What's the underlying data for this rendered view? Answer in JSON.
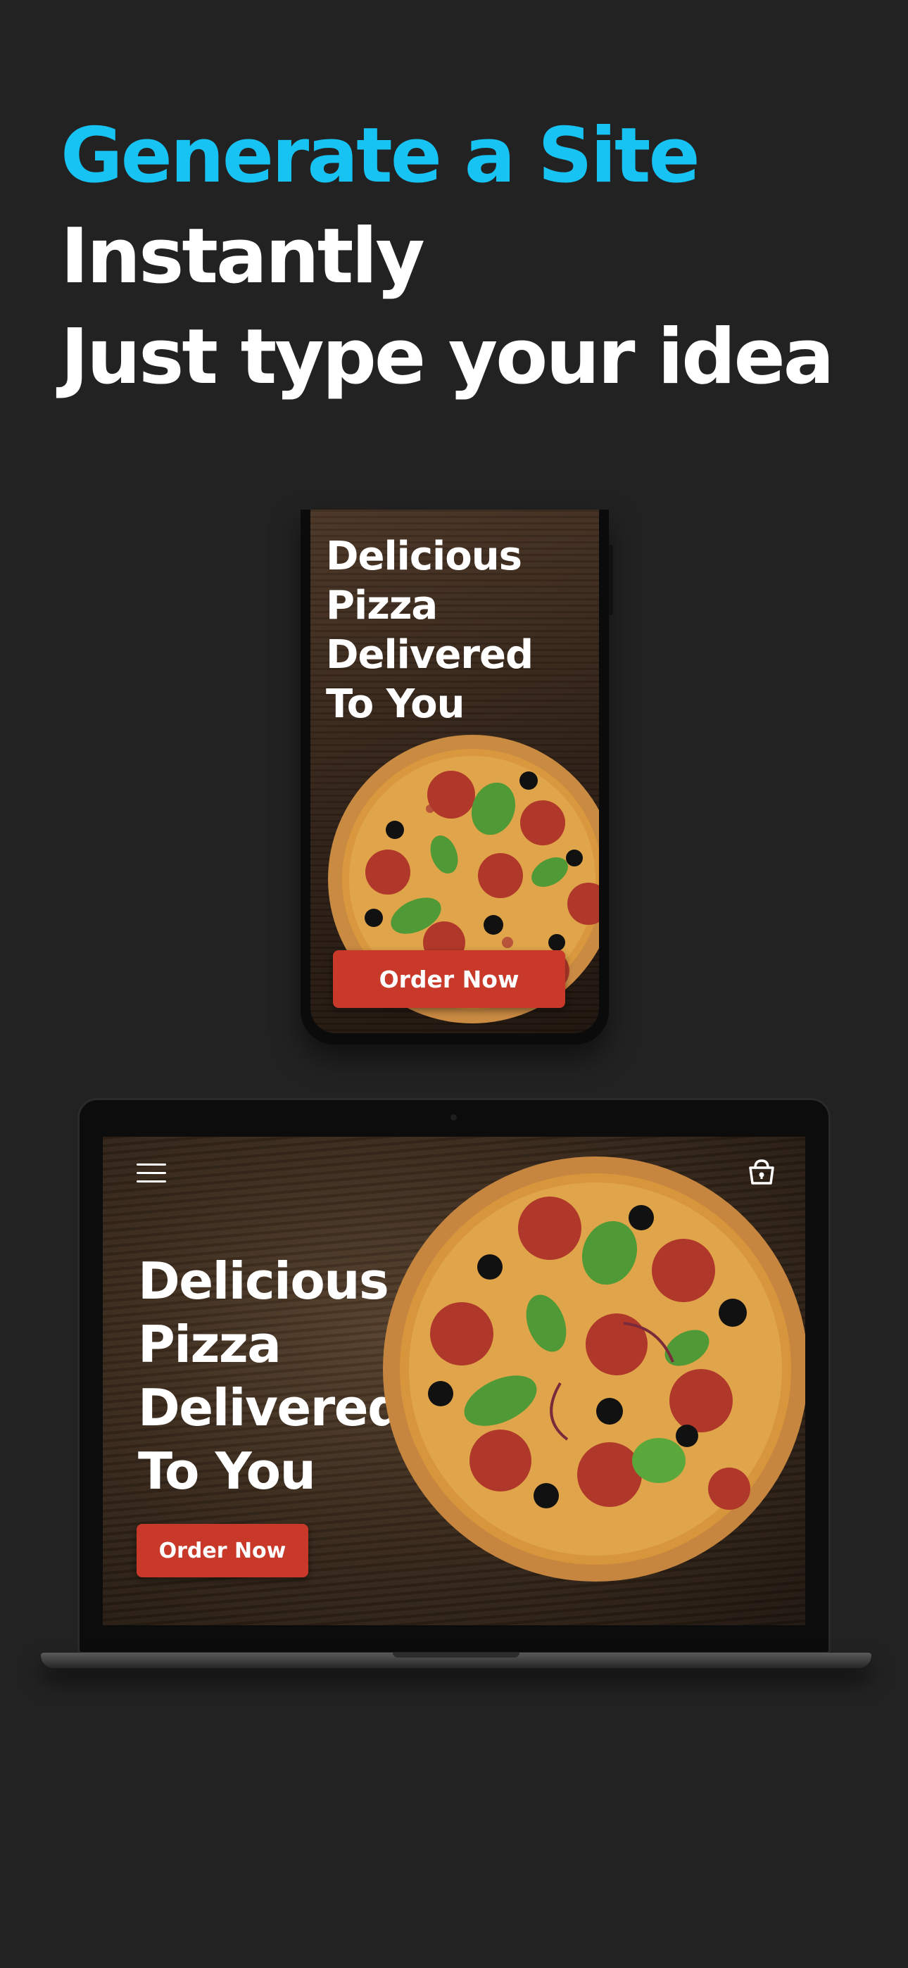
{
  "headline": {
    "line1": "Generate a Site",
    "line2": "Instantly",
    "line3": "Just type your idea"
  },
  "phone": {
    "title_lines": [
      "Delicious",
      "Pizza",
      "Delivered",
      "To You"
    ],
    "order_label": "Order Now"
  },
  "laptop": {
    "title_lines": [
      "Delicious",
      "Pizza",
      "Delivered",
      "To You"
    ],
    "order_label": "Order Now",
    "menu_icon": "hamburger-menu-icon",
    "cart_icon": "shopping-bag-icon"
  },
  "colors": {
    "accent": "#16c3f3",
    "background": "#222222",
    "button": "#c8392a"
  }
}
